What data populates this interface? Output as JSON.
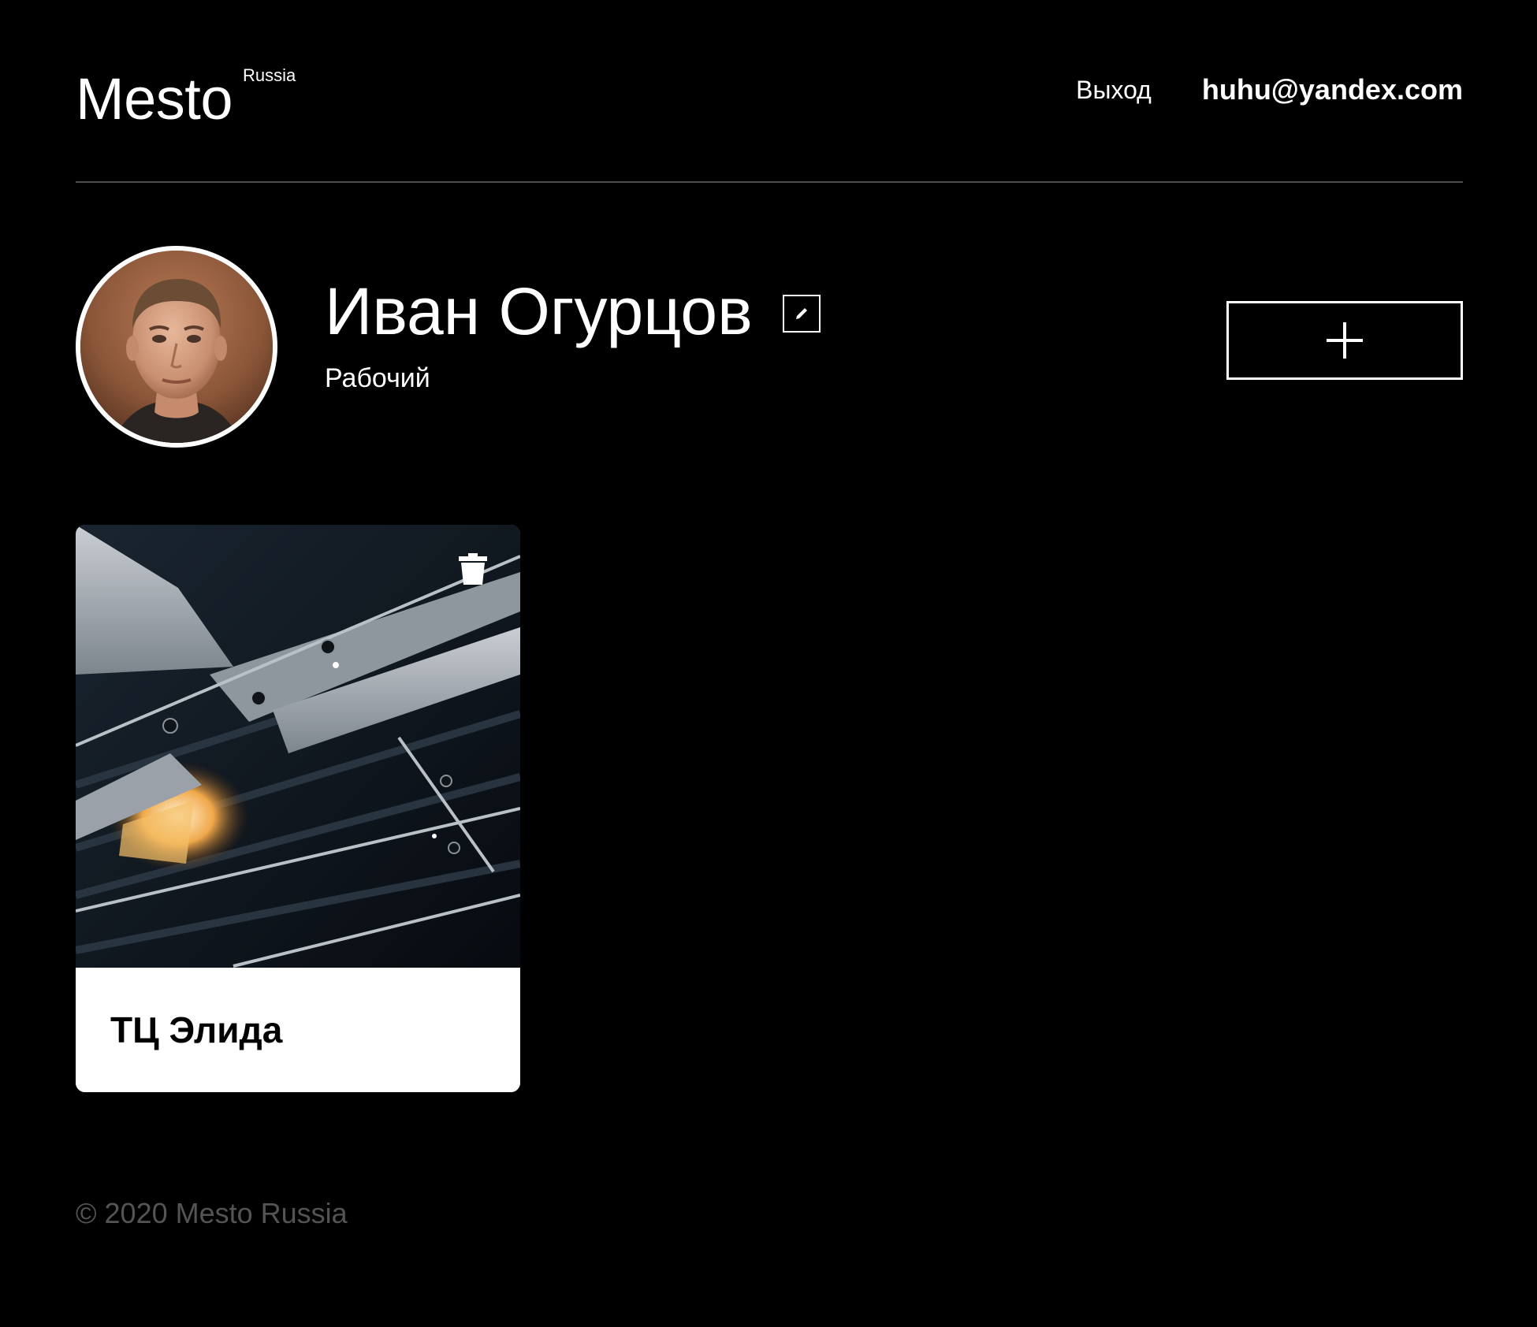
{
  "header": {
    "logo_text": "Mesto",
    "logo_sub": "Russia",
    "logout_label": "Выход",
    "email": "huhu@yandex.com"
  },
  "profile": {
    "name": "Иван Огурцов",
    "job": "Рабочий",
    "edit_icon": "pencil-icon",
    "add_icon": "plus-icon"
  },
  "cards": [
    {
      "title": "ТЦ Элида",
      "delete_icon": "trash-icon"
    }
  ],
  "footer": {
    "copyright": "© 2020 Mesto Russia"
  },
  "colors": {
    "background": "#000000",
    "text": "#ffffff",
    "divider": "#545454",
    "footer_text": "#545454",
    "card_caption_bg": "#ffffff",
    "card_title": "#000000"
  }
}
